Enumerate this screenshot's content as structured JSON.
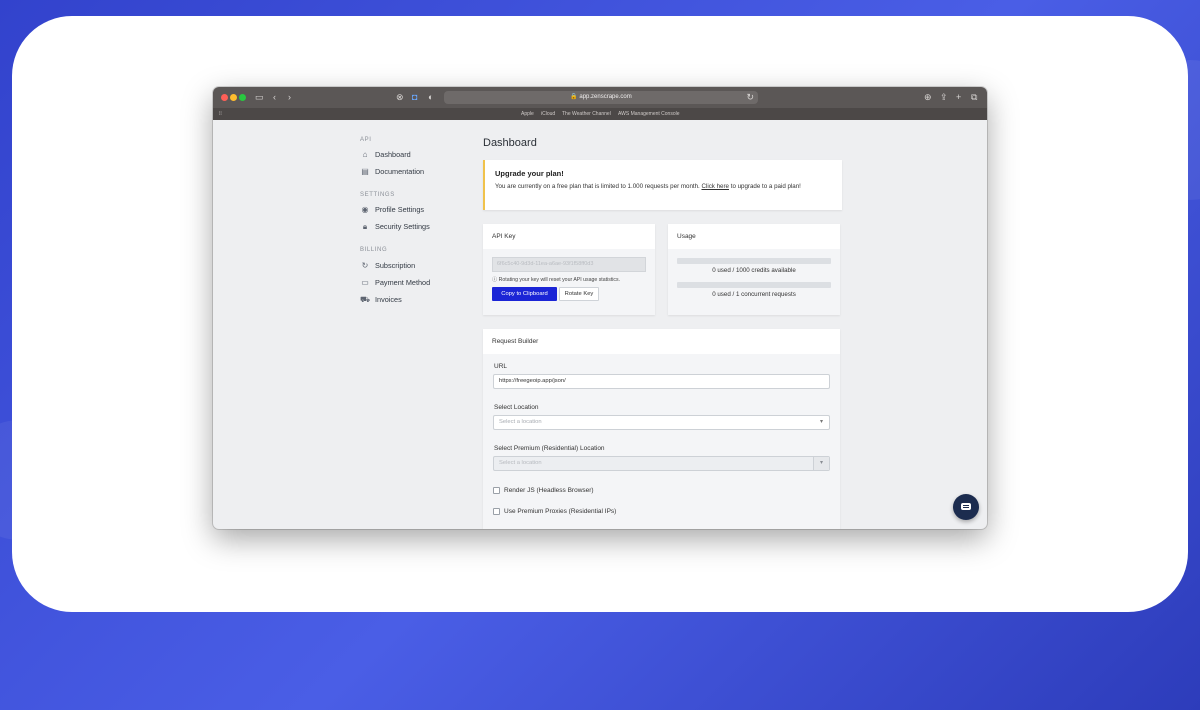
{
  "browser": {
    "url": "app.zenscrape.com",
    "favorites": [
      "Apple",
      "iCloud",
      "The Weather Channel",
      "AWS Management Console"
    ]
  },
  "sidebar": {
    "sections": [
      {
        "title": "API",
        "items": [
          {
            "label": "Dashboard",
            "icon": "home-icon"
          },
          {
            "label": "Documentation",
            "icon": "document-icon"
          }
        ]
      },
      {
        "title": "SETTINGS",
        "items": [
          {
            "label": "Profile Settings",
            "icon": "user-icon"
          },
          {
            "label": "Security Settings",
            "icon": "lock-icon"
          }
        ]
      },
      {
        "title": "BILLING",
        "items": [
          {
            "label": "Subscription",
            "icon": "refresh-icon"
          },
          {
            "label": "Payment Method",
            "icon": "card-icon"
          },
          {
            "label": "Invoices",
            "icon": "cart-icon"
          }
        ]
      }
    ]
  },
  "main": {
    "title": "Dashboard",
    "alert": {
      "title": "Upgrade your plan!",
      "text_before": "You are currently on a free plan that is limited to 1.000 requests per month. ",
      "link": "Click here",
      "text_after": " to upgrade to a paid plan!"
    },
    "api_key": {
      "header": "API Key",
      "value": "6f6c5c40-9d3d-11ea-a6ae-93f1f58ff0d3",
      "note": "Rotating your key will reset your API usage statistics.",
      "copy_label": "Copy to Clipboard",
      "rotate_label": "Rotate Key"
    },
    "usage": {
      "header": "Usage",
      "credits_text": "0 used / 1000 credits available",
      "credits_fraction": 0,
      "concurrent_text": "0 used / 1 concurrent requests",
      "concurrent_fraction": 0
    },
    "request_builder": {
      "header": "Request Builder",
      "url_label": "URL",
      "url_value": "https://freegeoip.app/json/",
      "location_label": "Select Location",
      "location_placeholder": "Select a location",
      "premium_label": "Select Premium (Residential) Location",
      "premium_placeholder": "Select a location",
      "render_js_label": "Render JS (Headless Browser)",
      "premium_proxies_label": "Use Premium Proxies (Residential IPs)"
    }
  },
  "colors": {
    "accent": "#1b25d6",
    "alert_border": "#f0c24b",
    "background": "#3b4fd6"
  }
}
